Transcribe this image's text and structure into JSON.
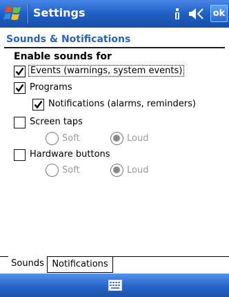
{
  "titlebar": {
    "title": "Settings",
    "ok_label": "ok",
    "icons": [
      "windows-start-icon",
      "connectivity-icon",
      "volume-icon"
    ]
  },
  "page": {
    "title": "Sounds & Notifications",
    "section_heading": "Enable sounds for"
  },
  "options": {
    "events": {
      "label": "Events (warnings, system events)",
      "checked": true
    },
    "programs": {
      "label": "Programs",
      "checked": true
    },
    "notifications": {
      "label": "Notifications (alarms, reminders)",
      "checked": true
    },
    "screen_taps": {
      "label": "Screen taps",
      "checked": false,
      "soft_label": "Soft",
      "loud_label": "Loud",
      "selected": "Loud"
    },
    "hardware_buttons": {
      "label": "Hardware buttons",
      "checked": false,
      "soft_label": "Soft",
      "loud_label": "Loud",
      "selected": "Loud"
    }
  },
  "tabs": [
    {
      "label": "Sounds",
      "active": true
    },
    {
      "label": "Notifications",
      "active": false
    }
  ],
  "menubar": {
    "icon": "keyboard-icon"
  },
  "colors": {
    "titlebar": "#1f5fc4",
    "header_text": "#2b64b3",
    "disabled_text": "#9a9a9a"
  }
}
